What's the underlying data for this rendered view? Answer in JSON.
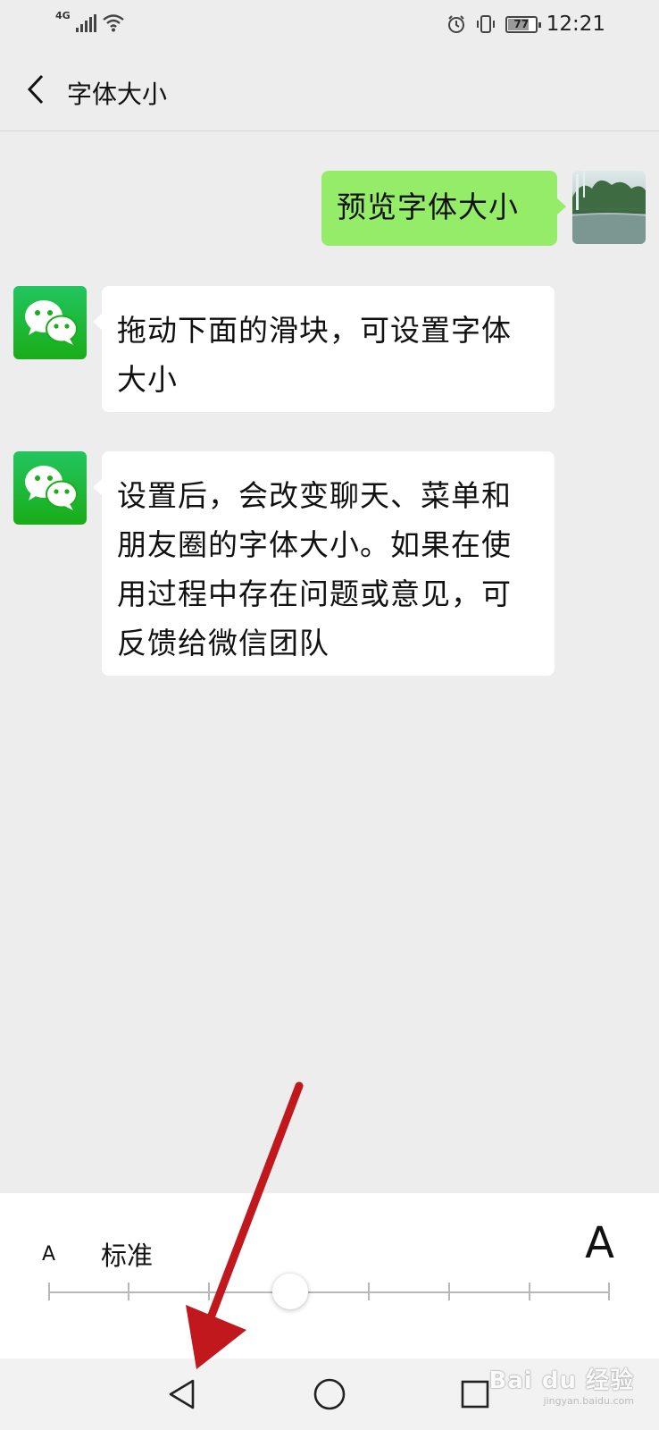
{
  "status_bar": {
    "network": "4G",
    "battery": "77",
    "time": "12:21"
  },
  "header": {
    "title": "字体大小"
  },
  "chat": {
    "messages": [
      {
        "sender": "me",
        "text": "预览字体大小"
      },
      {
        "sender": "wechat",
        "text": "拖动下面的滑块，可设置字体大小"
      },
      {
        "sender": "wechat",
        "text": "设置后，会改变聊天、菜单和朋友圈的字体大小。如果在使用过程中存在问题或意见，可反馈给微信团队"
      }
    ]
  },
  "font_slider": {
    "small_label": "A",
    "current_label": "标准",
    "large_label": "A",
    "steps": 8,
    "selected_step": 4
  },
  "system_nav": {
    "icons": [
      "back-triangle-icon",
      "home-circle-icon",
      "recents-square-icon"
    ]
  },
  "watermark": {
    "brand": "Bai du 经验",
    "url": "jingyan.baidu.com"
  },
  "colors": {
    "background": "#ededed",
    "my_bubble": "#95ec69",
    "other_bubble": "#ffffff",
    "wechat_green": "#1aad19",
    "annotation_arrow": "#c0181c"
  }
}
